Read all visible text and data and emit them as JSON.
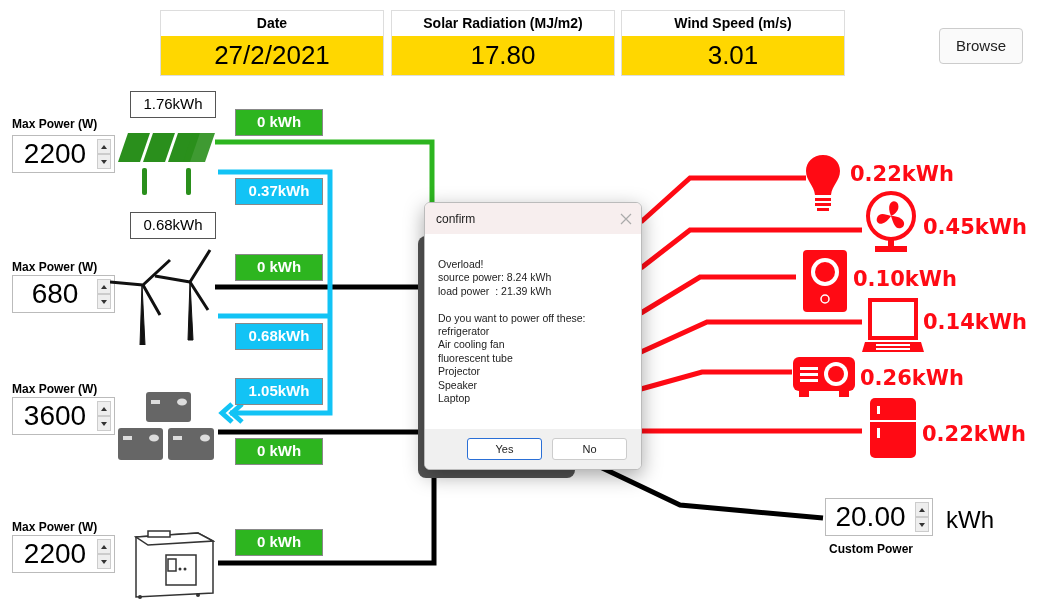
{
  "header": [
    {
      "label": "Date",
      "value": "27/2/2021"
    },
    {
      "label": "Solar Radiation (MJ/m2)",
      "value": "17.80"
    },
    {
      "label": "Wind Speed (m/s)",
      "value": "3.01"
    }
  ],
  "browse_button": "Browse",
  "sources": [
    {
      "kind": "solar",
      "max_power_label": "Max Power (W)",
      "max_power": "2200",
      "rating": "1.76kWh",
      "output": "0 kWh"
    },
    {
      "kind": "wind",
      "max_power_label": "Max Power (W)",
      "max_power": "680",
      "rating": "0.68kWh",
      "output": "0 kWh"
    },
    {
      "kind": "battery",
      "max_power_label": "Max Power (W)",
      "max_power": "3600",
      "output": "0 kWh"
    },
    {
      "kind": "generator",
      "max_power_label": "Max Power (W)",
      "max_power": "2200",
      "output": "0 kWh"
    }
  ],
  "transfers": [
    "0.37kWh",
    "0.68kWh",
    "1.05kWh"
  ],
  "loads": [
    {
      "kind": "bulb",
      "energy": "0.22kWh"
    },
    {
      "kind": "fan",
      "energy": "0.45kWh"
    },
    {
      "kind": "speaker",
      "energy": "0.10kWh"
    },
    {
      "kind": "laptop",
      "energy": "0.14kWh"
    },
    {
      "kind": "projector",
      "energy": "0.26kWh"
    },
    {
      "kind": "fridge",
      "energy": "0.22kWh"
    }
  ],
  "custom_power": {
    "value": "20.00",
    "unit": "kWh",
    "label": "Custom Power"
  },
  "dialog": {
    "title": "confirm",
    "message": [
      "Overload!",
      "source power: 8.24 kWh",
      "load power  : 21.39 kWh"
    ],
    "question": "Do you want to power off these:",
    "items": [
      "refrigerator",
      "Air cooling fan",
      "fluorescent tube",
      "Projector",
      "Speaker",
      "Laptop"
    ],
    "buttons": [
      "Yes",
      "No"
    ]
  }
}
